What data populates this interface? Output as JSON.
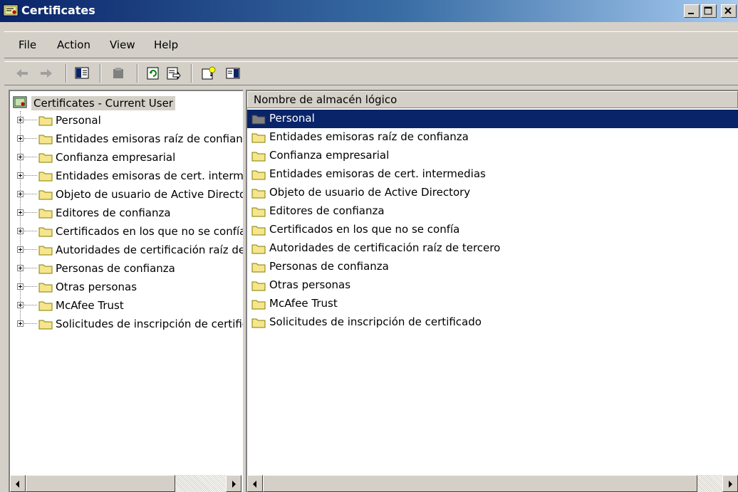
{
  "window": {
    "title": "Certificates",
    "icon": "certificate-app-icon",
    "buttons": [
      "minimize-icon",
      "restore-icon",
      "close-icon"
    ]
  },
  "menu": {
    "file": "File",
    "action": "Action",
    "view": "View",
    "help": "Help"
  },
  "toolbar": {
    "icons": [
      "back-arrow-icon",
      "forward-arrow-icon",
      "show-hide-tree-icon",
      "delete-icon",
      "refresh-icon",
      "export-list-icon",
      "help-icon",
      "show-hide-action-pane-icon"
    ]
  },
  "tree": {
    "root_label": "Certificates - Current User",
    "items": [
      {
        "label": "Personal"
      },
      {
        "label": "Entidades emisoras raíz de confianza"
      },
      {
        "label": "Confianza empresarial"
      },
      {
        "label": "Entidades emisoras de cert. intermedias"
      },
      {
        "label": "Objeto de usuario de Active Directory"
      },
      {
        "label": "Editores de confianza"
      },
      {
        "label": "Certificados en los que no se confía"
      },
      {
        "label": "Autoridades de certificación raíz de tercero"
      },
      {
        "label": "Personas de confianza"
      },
      {
        "label": "Otras personas"
      },
      {
        "label": "McAfee Trust"
      },
      {
        "label": "Solicitudes de inscripción de certificado"
      }
    ]
  },
  "list": {
    "column_header": "Nombre de almacén lógico",
    "selected_index": 0,
    "items": [
      {
        "label": "Personal"
      },
      {
        "label": "Entidades emisoras raíz de confianza"
      },
      {
        "label": "Confianza empresarial"
      },
      {
        "label": "Entidades emisoras de cert. intermedias"
      },
      {
        "label": "Objeto de usuario de Active Directory"
      },
      {
        "label": "Editores de confianza"
      },
      {
        "label": "Certificados en los que no se confía"
      },
      {
        "label": "Autoridades de certificación raíz de tercero"
      },
      {
        "label": "Personas de confianza"
      },
      {
        "label": "Otras personas"
      },
      {
        "label": "McAfee Trust"
      },
      {
        "label": "Solicitudes de inscripción de certificado"
      }
    ]
  },
  "colors": {
    "selection": "#0a246a",
    "folder": "#f6e58d",
    "chrome": "#d4d0c8"
  }
}
